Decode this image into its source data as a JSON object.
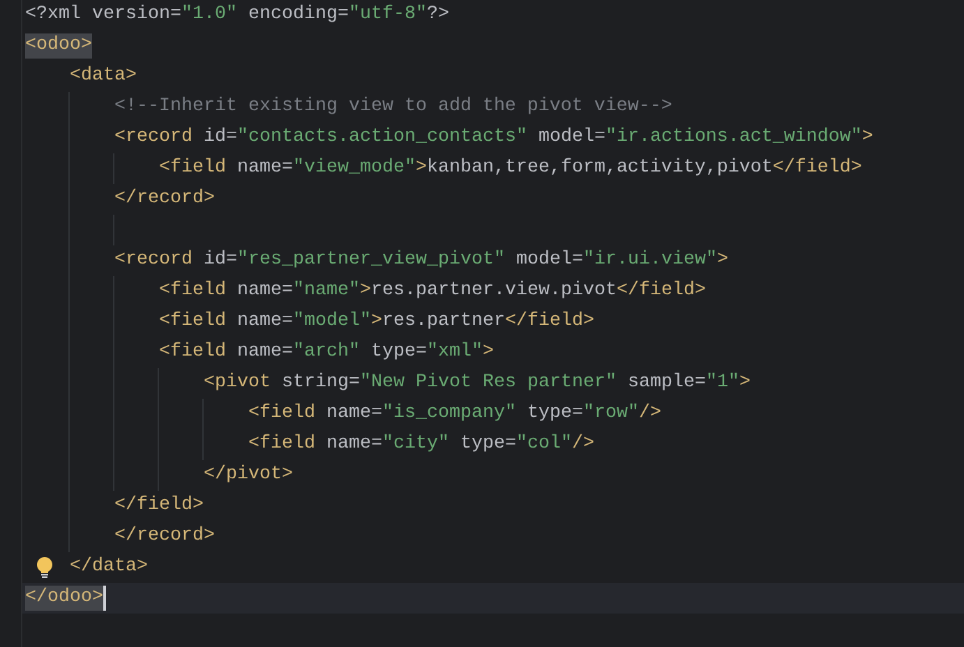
{
  "editor": {
    "lines": [
      {
        "current": false,
        "matched": false,
        "hint": false,
        "caret": false,
        "tokens": [
          {
            "kind": "text",
            "text": "<?xml version="
          },
          {
            "kind": "value",
            "text": "\"1.0\""
          },
          {
            "kind": "text",
            "text": " encoding="
          },
          {
            "kind": "value",
            "text": "\"utf-8\""
          },
          {
            "kind": "text",
            "text": "?>"
          }
        ]
      },
      {
        "current": false,
        "matched": true,
        "hint": false,
        "caret": false,
        "tokens": [
          {
            "kind": "tag",
            "text": "<odoo>"
          }
        ]
      },
      {
        "current": false,
        "matched": false,
        "hint": false,
        "caret": false,
        "tokens": [
          {
            "kind": "tag",
            "text": "    <data>"
          }
        ]
      },
      {
        "current": false,
        "matched": false,
        "hint": false,
        "caret": false,
        "tokens": [
          {
            "kind": "comment",
            "text": "        <!--Inherit existing view to add the pivot view-->"
          }
        ]
      },
      {
        "current": false,
        "matched": false,
        "hint": false,
        "caret": false,
        "tokens": [
          {
            "kind": "tag",
            "text": "        <record"
          },
          {
            "kind": "text",
            "text": " id="
          },
          {
            "kind": "value",
            "text": "\"contacts.action_contacts\""
          },
          {
            "kind": "text",
            "text": " model="
          },
          {
            "kind": "value",
            "text": "\"ir.actions.act_window\""
          },
          {
            "kind": "tag",
            "text": ">"
          }
        ]
      },
      {
        "current": false,
        "matched": false,
        "hint": false,
        "caret": false,
        "tokens": [
          {
            "kind": "tag",
            "text": "            <field"
          },
          {
            "kind": "text",
            "text": " name="
          },
          {
            "kind": "value",
            "text": "\"view_mode\""
          },
          {
            "kind": "tag",
            "text": ">"
          },
          {
            "kind": "text",
            "text": "kanban,tree,form,activity,pivot"
          },
          {
            "kind": "tag",
            "text": "</field>"
          }
        ]
      },
      {
        "current": false,
        "matched": false,
        "hint": false,
        "caret": false,
        "tokens": [
          {
            "kind": "tag",
            "text": "        </record>"
          }
        ]
      },
      {
        "current": false,
        "matched": false,
        "hint": false,
        "caret": false
      },
      {
        "current": false,
        "matched": false,
        "hint": false,
        "caret": false,
        "tokens": [
          {
            "kind": "tag",
            "text": "        <record"
          },
          {
            "kind": "text",
            "text": " id="
          },
          {
            "kind": "value",
            "text": "\"res_partner_view_pivot\""
          },
          {
            "kind": "text",
            "text": " model="
          },
          {
            "kind": "value",
            "text": "\"ir.ui.view\""
          },
          {
            "kind": "tag",
            "text": ">"
          }
        ]
      },
      {
        "current": false,
        "matched": false,
        "hint": false,
        "caret": false,
        "tokens": [
          {
            "kind": "tag",
            "text": "            <field"
          },
          {
            "kind": "text",
            "text": " name="
          },
          {
            "kind": "value",
            "text": "\"name\""
          },
          {
            "kind": "tag",
            "text": ">"
          },
          {
            "kind": "text",
            "text": "res.partner.view.pivot"
          },
          {
            "kind": "tag",
            "text": "</field>"
          }
        ]
      },
      {
        "current": false,
        "matched": false,
        "hint": false,
        "caret": false,
        "tokens": [
          {
            "kind": "tag",
            "text": "            <field"
          },
          {
            "kind": "text",
            "text": " name="
          },
          {
            "kind": "value",
            "text": "\"model\""
          },
          {
            "kind": "tag",
            "text": ">"
          },
          {
            "kind": "text",
            "text": "res.partner"
          },
          {
            "kind": "tag",
            "text": "</field>"
          }
        ]
      },
      {
        "current": false,
        "matched": false,
        "hint": false,
        "caret": false,
        "tokens": [
          {
            "kind": "tag",
            "text": "            <field"
          },
          {
            "kind": "text",
            "text": " name="
          },
          {
            "kind": "value",
            "text": "\"arch\""
          },
          {
            "kind": "text",
            "text": " type="
          },
          {
            "kind": "value",
            "text": "\"xml\""
          },
          {
            "kind": "tag",
            "text": ">"
          }
        ]
      },
      {
        "current": false,
        "matched": false,
        "hint": false,
        "caret": false,
        "tokens": [
          {
            "kind": "tag",
            "text": "                <pivot"
          },
          {
            "kind": "text",
            "text": " string="
          },
          {
            "kind": "value",
            "text": "\"New Pivot Res partner\""
          },
          {
            "kind": "text",
            "text": " sample="
          },
          {
            "kind": "value",
            "text": "\"1\""
          },
          {
            "kind": "tag",
            "text": ">"
          }
        ]
      },
      {
        "current": false,
        "matched": false,
        "hint": false,
        "caret": false,
        "tokens": [
          {
            "kind": "tag",
            "text": "                    <field"
          },
          {
            "kind": "text",
            "text": " name="
          },
          {
            "kind": "value",
            "text": "\"is_company\""
          },
          {
            "kind": "text",
            "text": " type="
          },
          {
            "kind": "value",
            "text": "\"row\""
          },
          {
            "kind": "tag",
            "text": "/>"
          }
        ]
      },
      {
        "current": false,
        "matched": false,
        "hint": false,
        "caret": false,
        "tokens": [
          {
            "kind": "tag",
            "text": "                    <field"
          },
          {
            "kind": "text",
            "text": " name="
          },
          {
            "kind": "value",
            "text": "\"city\""
          },
          {
            "kind": "text",
            "text": " type="
          },
          {
            "kind": "value",
            "text": "\"col\""
          },
          {
            "kind": "tag",
            "text": "/>"
          }
        ]
      },
      {
        "current": false,
        "matched": false,
        "hint": false,
        "caret": false,
        "tokens": [
          {
            "kind": "tag",
            "text": "                </pivot>"
          }
        ]
      },
      {
        "current": false,
        "matched": false,
        "hint": false,
        "caret": false,
        "tokens": [
          {
            "kind": "tag",
            "text": "        </field>"
          }
        ]
      },
      {
        "current": false,
        "matched": false,
        "hint": false,
        "caret": false,
        "tokens": [
          {
            "kind": "tag",
            "text": "        </record>"
          }
        ]
      },
      {
        "current": false,
        "matched": false,
        "hint": true,
        "caret": false,
        "tokens": [
          {
            "kind": "tag",
            "text": "    </data>"
          }
        ]
      },
      {
        "current": true,
        "matched": true,
        "hint": false,
        "caret": true,
        "tokens": [
          {
            "kind": "tag",
            "text": "</odoo>"
          }
        ]
      }
    ]
  }
}
